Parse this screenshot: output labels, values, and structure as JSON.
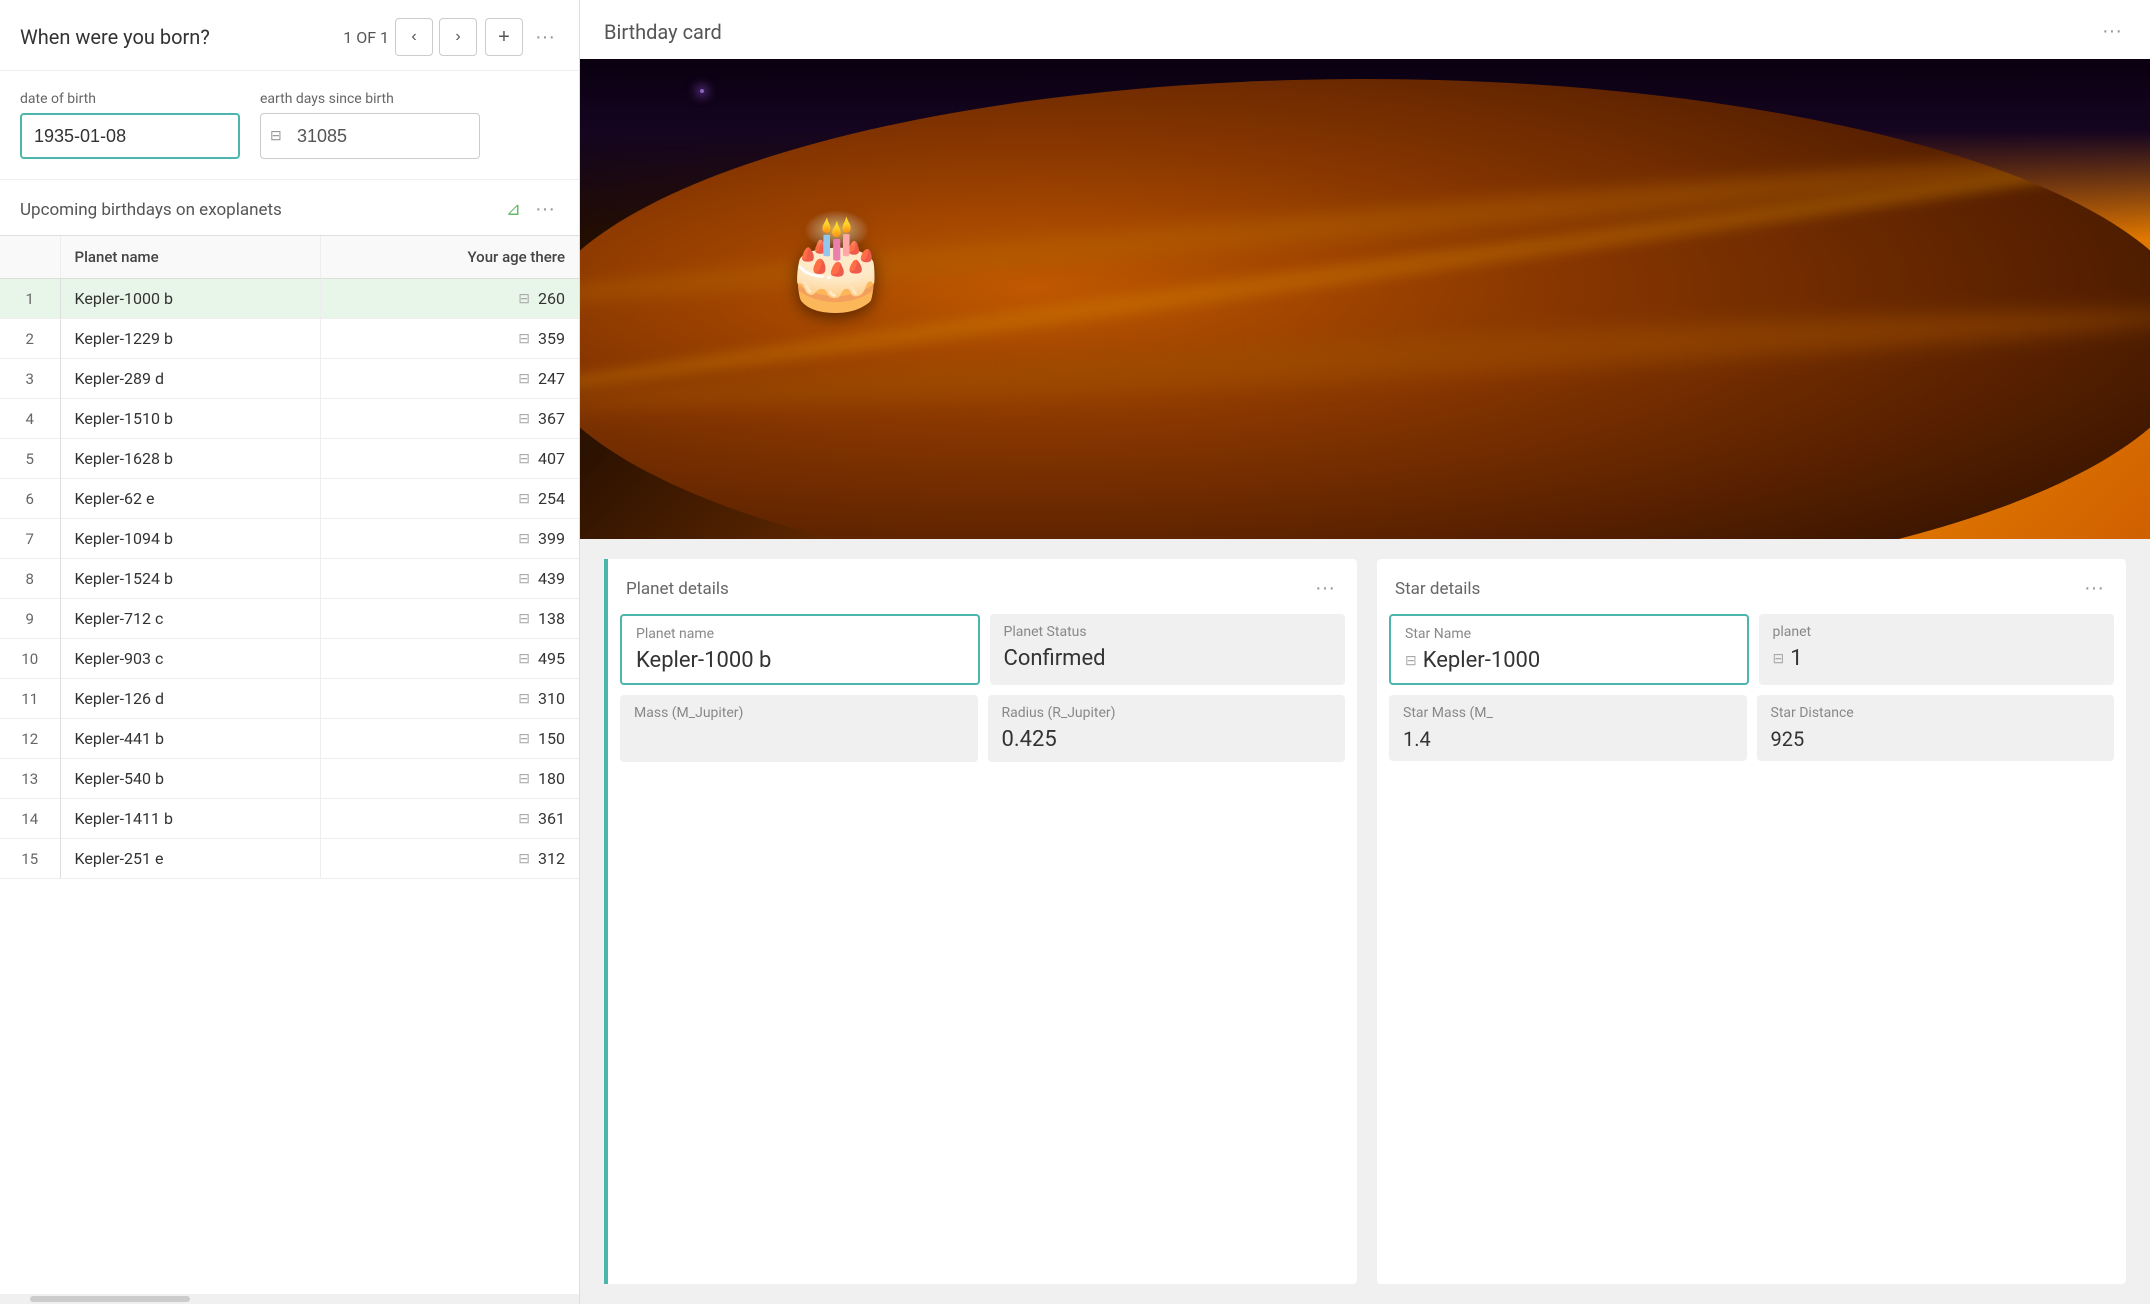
{
  "left_panel": {
    "header": {
      "title": "When were you born?",
      "record_count": "1 OF 1"
    },
    "birth_form": {
      "date_label": "date of birth",
      "date_value": "1935-01-08",
      "days_label": "earth days since birth",
      "days_value": "31085"
    },
    "birthdays_section": {
      "title": "Upcoming birthdays on exoplanets",
      "table": {
        "headers": [
          "",
          "Planet name",
          "Your age there"
        ],
        "rows": [
          {
            "index": 1,
            "planet": "Kepler-1000 b",
            "age": 260,
            "selected": true
          },
          {
            "index": 2,
            "planet": "Kepler-1229 b",
            "age": 359,
            "selected": false
          },
          {
            "index": 3,
            "planet": "Kepler-289 d",
            "age": 247,
            "selected": false
          },
          {
            "index": 4,
            "planet": "Kepler-1510 b",
            "age": 367,
            "selected": false
          },
          {
            "index": 5,
            "planet": "Kepler-1628 b",
            "age": 407,
            "selected": false
          },
          {
            "index": 6,
            "planet": "Kepler-62 e",
            "age": 254,
            "selected": false
          },
          {
            "index": 7,
            "planet": "Kepler-1094 b",
            "age": 399,
            "selected": false
          },
          {
            "index": 8,
            "planet": "Kepler-1524 b",
            "age": 439,
            "selected": false
          },
          {
            "index": 9,
            "planet": "Kepler-712 c",
            "age": 138,
            "selected": false
          },
          {
            "index": 10,
            "planet": "Kepler-903 c",
            "age": 495,
            "selected": false
          },
          {
            "index": 11,
            "planet": "Kepler-126 d",
            "age": 310,
            "selected": false
          },
          {
            "index": 12,
            "planet": "Kepler-441 b",
            "age": 150,
            "selected": false
          },
          {
            "index": 13,
            "planet": "Kepler-540 b",
            "age": 180,
            "selected": false
          },
          {
            "index": 14,
            "planet": "Kepler-1411 b",
            "age": 361,
            "selected": false
          },
          {
            "index": 15,
            "planet": "Kepler-251 e",
            "age": 312,
            "selected": false
          }
        ]
      }
    }
  },
  "right_panel": {
    "birthday_card": {
      "title": "Birthday card"
    },
    "planet_details": {
      "title": "Planet details",
      "planet_name_label": "Planet name",
      "planet_name_value": "Kepler-1000 b",
      "planet_status_label": "Planet Status",
      "planet_status_value": "Confirmed",
      "mass_label": "Mass (M_Jupiter)",
      "mass_value": "",
      "radius_label": "Radius (R_Jupiter)",
      "radius_value": "0.425"
    },
    "star_details": {
      "title": "Star details",
      "star_name_label": "Star Name",
      "star_name_value": "Kepler-1000",
      "planet_count_label": "planet",
      "planet_count_value": "1",
      "star_mass_label": "Star Mass (M_",
      "star_mass_value": "1.4",
      "star_distance_label": "Star Distance",
      "star_distance_value": "925"
    }
  },
  "icons": {
    "prev": "‹",
    "next": "›",
    "add": "+",
    "more": "···",
    "filter": "⊿",
    "db": "⊟",
    "lock": "⊟"
  }
}
